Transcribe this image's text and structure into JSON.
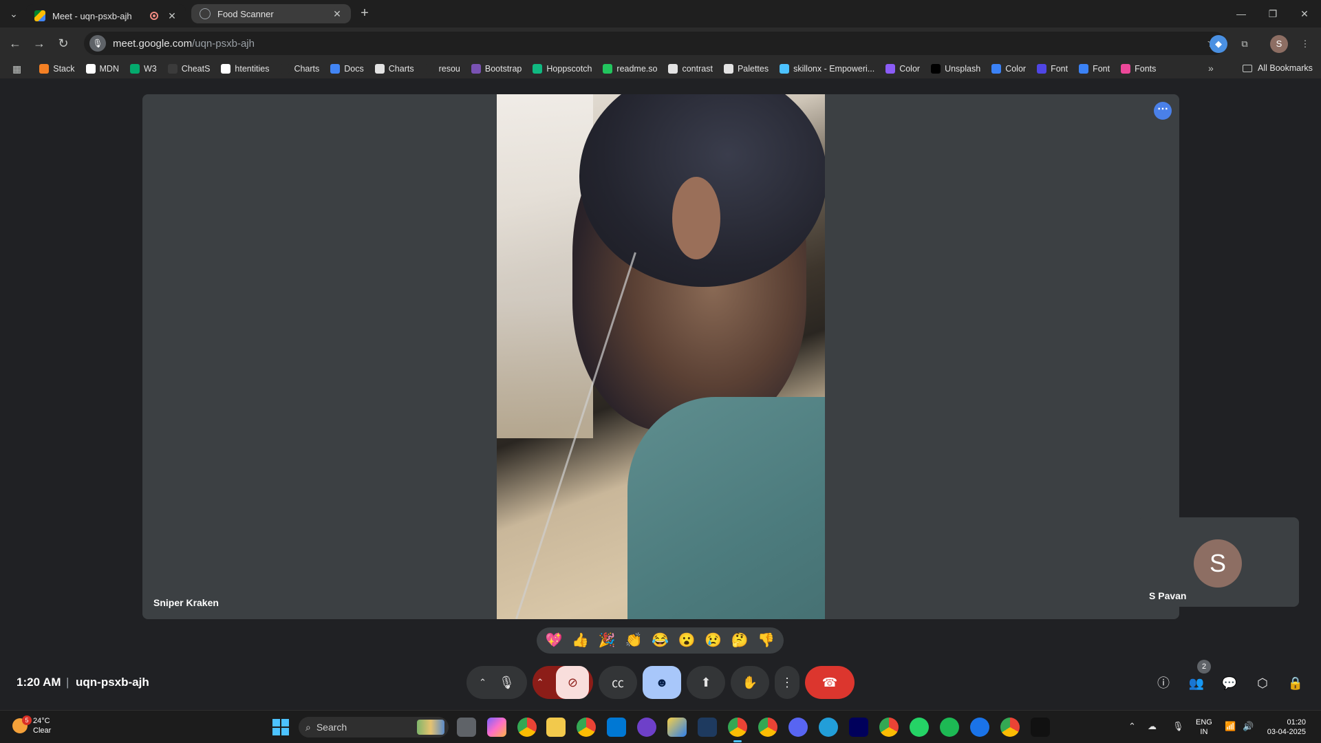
{
  "browser": {
    "tabs": [
      {
        "title": "Meet - uqn-psxb-ajh",
        "recording": true,
        "active": true
      },
      {
        "title": "Food Scanner",
        "active": false
      }
    ],
    "url_host": "meet.google.com",
    "url_path": "/uqn-psxb-ajh",
    "profile_initial": "S",
    "bookmarks": [
      {
        "label": "Stack",
        "color": "#f48024"
      },
      {
        "label": "MDN",
        "color": "#ffffff"
      },
      {
        "label": "W3",
        "color": "#04aa6d"
      },
      {
        "label": "CheatS",
        "color": "#3b3b3b"
      },
      {
        "label": "htentities",
        "color": "#ffffff"
      },
      {
        "label": "Charts",
        "color": "#2b2b2b"
      },
      {
        "label": "Docs",
        "color": "#4285f4"
      },
      {
        "label": "Charts",
        "color": "#e3e3e3"
      },
      {
        "label": "resou",
        "color": "#2b2b2b"
      },
      {
        "label": "Bootstrap",
        "color": "#7952b3"
      },
      {
        "label": "Hoppscotch",
        "color": "#10b981"
      },
      {
        "label": "readme.so",
        "color": "#22c55e"
      },
      {
        "label": "contrast",
        "color": "#e3e3e3"
      },
      {
        "label": "Palettes",
        "color": "#e3e3e3"
      },
      {
        "label": "skillonx - Empoweri...",
        "color": "#4cc2ff"
      },
      {
        "label": "Color",
        "color": "#8b5cf6"
      },
      {
        "label": "Unsplash",
        "color": "#000000"
      },
      {
        "label": "Color",
        "color": "#3b82f6"
      },
      {
        "label": "Font",
        "color": "#4f46e5"
      },
      {
        "label": "Font",
        "color": "#3b82f6"
      },
      {
        "label": "Fonts",
        "color": "#ec4899"
      }
    ],
    "all_bookmarks": "All Bookmarks"
  },
  "meet": {
    "main_participant": "Sniper Kraken",
    "self_participant": "S Pavan",
    "self_initial": "S",
    "reactions": [
      "💖",
      "👍",
      "🎉",
      "👏",
      "😂",
      "😮",
      "😢",
      "🤔",
      "👎"
    ],
    "time": "1:20 AM",
    "separator": "|",
    "meeting_code": "uqn-psxb-ajh",
    "participant_count": "2"
  },
  "taskbar": {
    "weather_temp": "24°C",
    "weather_desc": "Clear",
    "weather_badge": "5",
    "search_placeholder": "Search",
    "lang_line1": "ENG",
    "lang_line2": "IN",
    "clock_time": "01:20",
    "clock_date": "03-04-2025"
  }
}
